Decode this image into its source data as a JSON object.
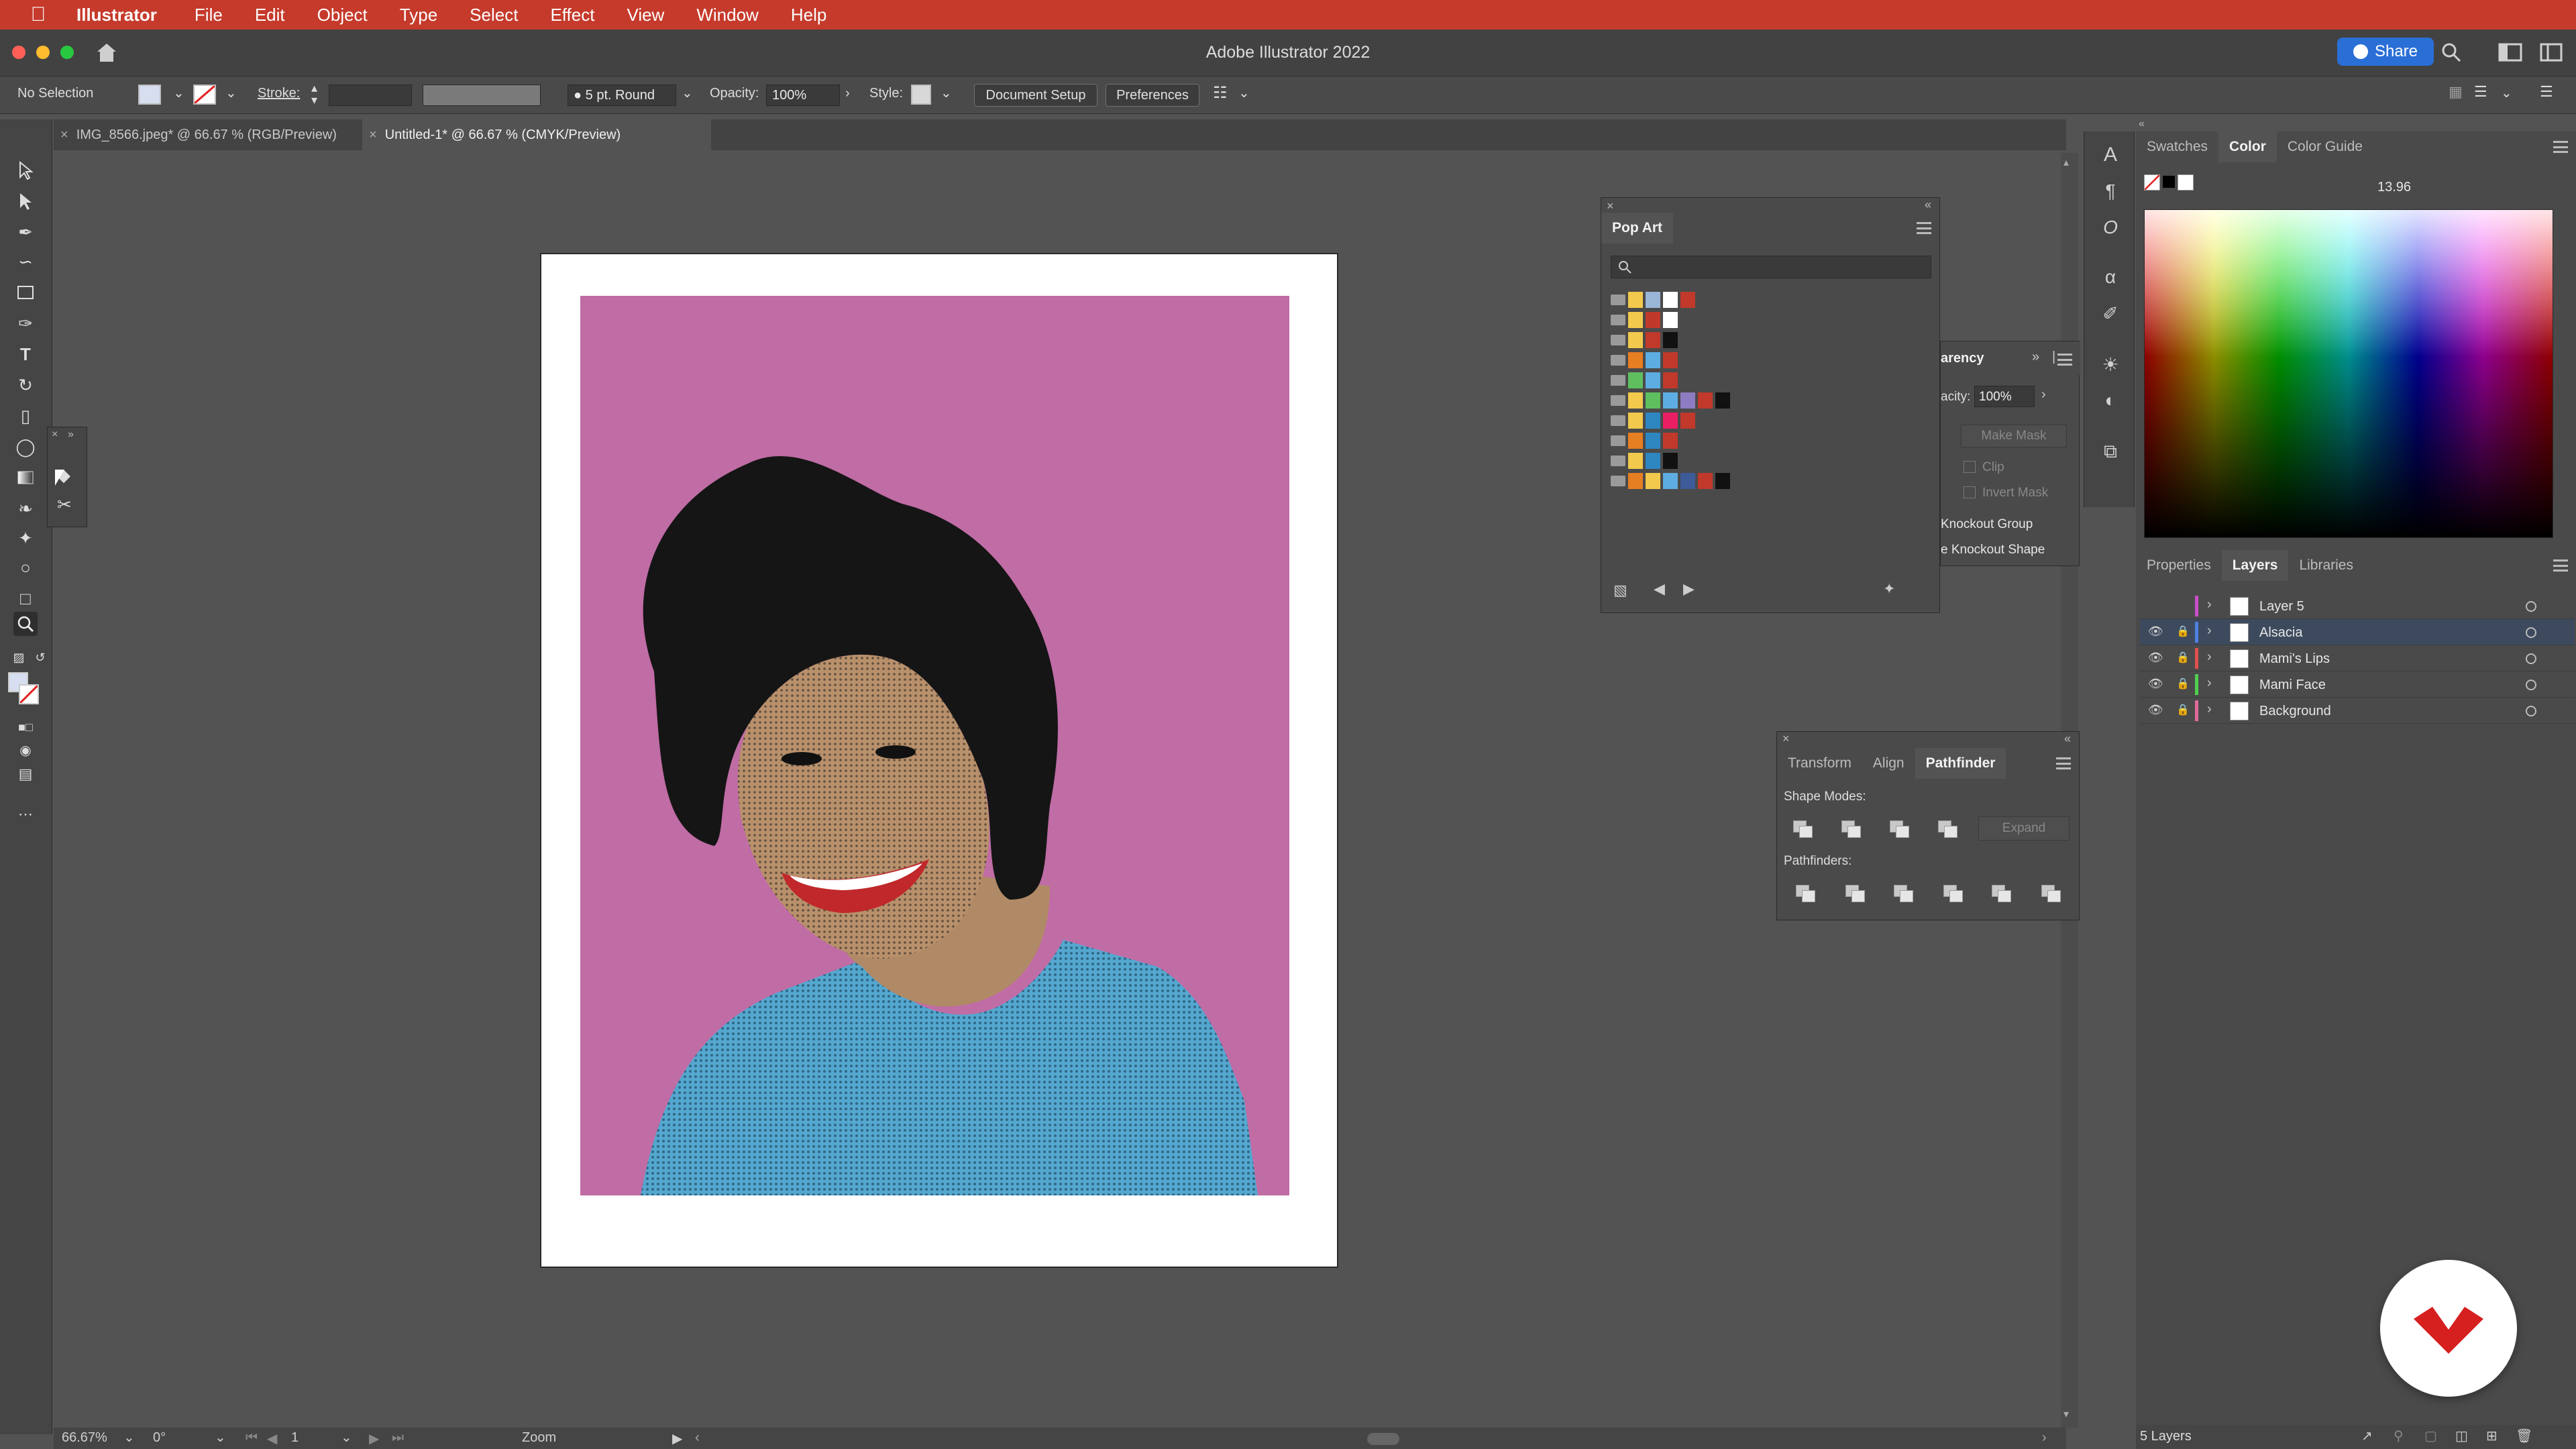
{
  "menubar": {
    "app": "Illustrator",
    "items": [
      "File",
      "Edit",
      "Object",
      "Type",
      "Select",
      "Effect",
      "View",
      "Window",
      "Help"
    ]
  },
  "window": {
    "title": "Adobe Illustrator 2022",
    "share_label": "Share"
  },
  "controlbar": {
    "selection": "No Selection",
    "stroke_label": "Stroke:",
    "brush_label": "5 pt. Round",
    "opacity_label": "Opacity:",
    "opacity_value": "100%",
    "style_label": "Style:",
    "document_setup": "Document Setup",
    "preferences": "Preferences"
  },
  "tabs": [
    {
      "label": "IMG_8566.jpeg* @ 66.67 % (RGB/Preview)"
    },
    {
      "label": "Untitled-1* @ 66.67 % (CMYK/Preview)"
    }
  ],
  "pop_art_panel": {
    "title": "Pop Art",
    "rows": [
      [
        "#f2c94c",
        "#9ab6d6",
        "#ffffff",
        "#c0392b"
      ],
      [
        "#f2c94c",
        "#c0392b",
        "#ffffff"
      ],
      [
        "#f2c94c",
        "#c0392b",
        "#111111"
      ],
      [
        "#e67e22",
        "#5dade2",
        "#c0392b"
      ],
      [
        "#5fbf5f",
        "#5dade2",
        "#c0392b"
      ],
      [
        "#f2c94c",
        "#5fbf5f",
        "#5dade2",
        "#8e7cc3",
        "#c0392b",
        "#111111"
      ],
      [
        "#f2c94c",
        "#2e86c1",
        "#e91e63",
        "#c0392b"
      ],
      [
        "#e67e22",
        "#2e86c1",
        "#c0392b"
      ],
      [
        "#f2c94c",
        "#2e86c1",
        "#111111"
      ],
      [
        "#e67e22",
        "#f2c94c",
        "#5dade2",
        "#3d5a99",
        "#c0392b",
        "#111111"
      ]
    ]
  },
  "transparency_panel": {
    "title_fragment": "arency",
    "opacity_fragment": "acity:",
    "opacity_value": "100%",
    "make_mask": "Make Mask",
    "clip": "Clip",
    "invert_mask": "Invert Mask",
    "knockout_group": "Knockout Group",
    "knockout_shape": "e Knockout Shape"
  },
  "pathfinder_panel": {
    "tabs": [
      "Transform",
      "Align",
      "Pathfinder"
    ],
    "shape_modes": "Shape Modes:",
    "expand": "Expand",
    "pathfinders": "Pathfinders:"
  },
  "color_panel": {
    "tabs": [
      "Swatches",
      "Color",
      "Color Guide"
    ],
    "value": "13.96"
  },
  "layers_panel": {
    "tabs": [
      "Properties",
      "Layers",
      "Libraries"
    ],
    "layers": [
      {
        "name": "Layer 5",
        "color": "#c94fc9",
        "visible": false
      },
      {
        "name": "Alsacia",
        "color": "#4f7fe0",
        "visible": true,
        "selected": true
      },
      {
        "name": "Mami's Lips",
        "color": "#e04f4f",
        "visible": true
      },
      {
        "name": "Mami Face",
        "color": "#4fd04f",
        "visible": true
      },
      {
        "name": "Background",
        "color": "#e06a9a",
        "visible": true
      }
    ],
    "count": "5 Layers"
  },
  "status": {
    "zoom": "66.67%",
    "rotation": "0°",
    "page": "1",
    "tool": "Zoom"
  }
}
